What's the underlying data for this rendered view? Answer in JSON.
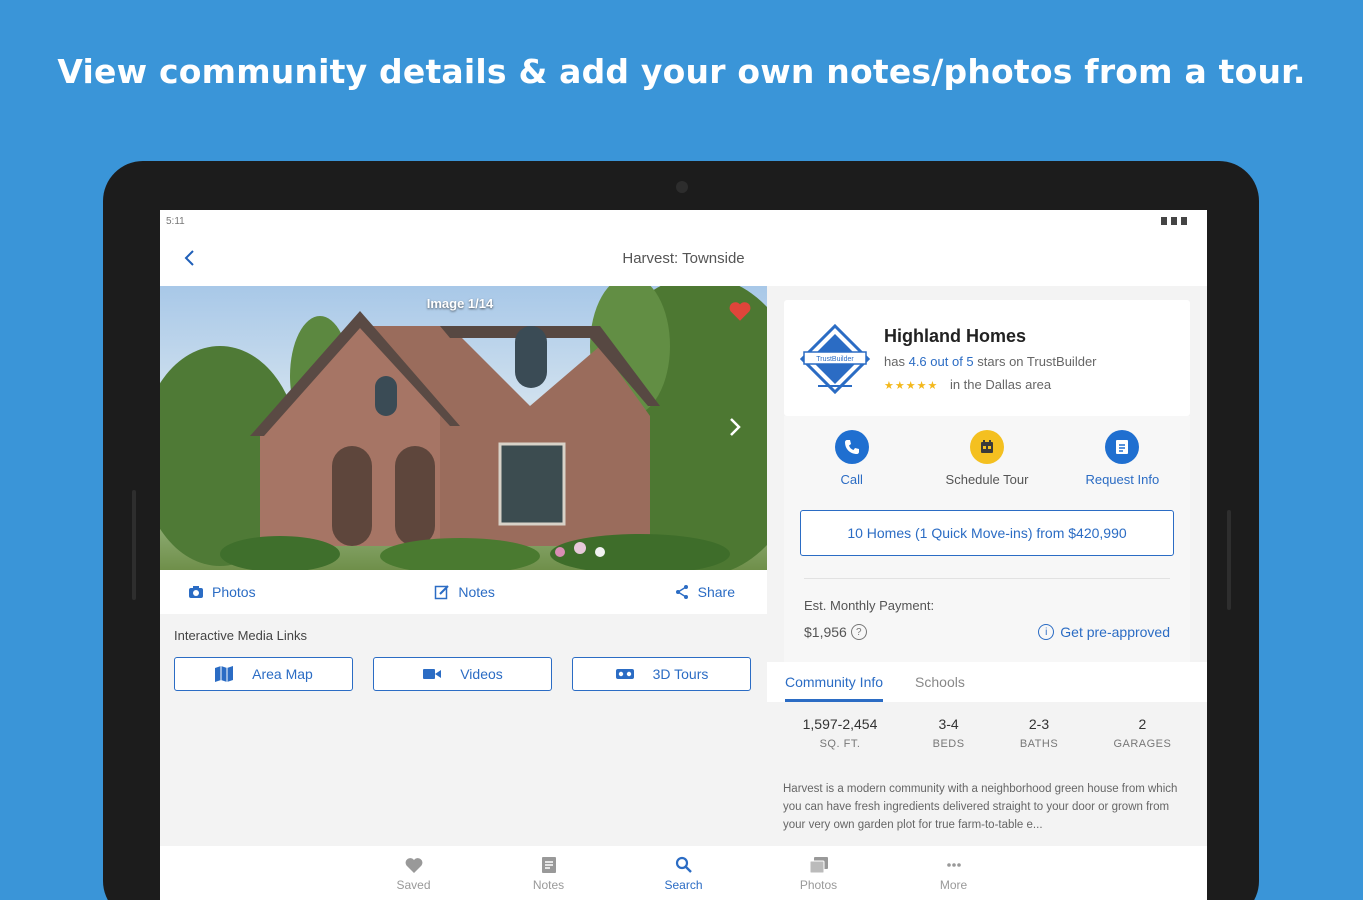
{
  "headline": "View community details & add your own notes/photos from a tour.",
  "status_bar": {
    "time": "5:11"
  },
  "app_bar": {
    "title": "Harvest: Townside"
  },
  "gallery": {
    "image_counter": "Image 1/14"
  },
  "photo_actions": {
    "photos": "Photos",
    "notes": "Notes",
    "share": "Share"
  },
  "media_links": {
    "title": "Interactive Media Links",
    "area_map": "Area Map",
    "videos": "Videos",
    "tours_3d": "3D Tours"
  },
  "builder": {
    "name": "Highland Homes",
    "rating_prefix": "has",
    "rating": "4.6 out of 5",
    "rating_suffix": "stars on TrustBuilder",
    "stars": "★★★★★",
    "area": "in the Dallas area",
    "logo_text": "TrustBuilder"
  },
  "contact": {
    "call": "Call",
    "schedule_tour": "Schedule Tour",
    "request_info": "Request Info",
    "call_color": "#1f6fd0",
    "schedule_color": "#f4c020",
    "request_color": "#1f6fd0"
  },
  "homes_button": "10 Homes (1 Quick Move-ins) from $420,990",
  "payment": {
    "label": "Est. Monthly Payment:",
    "value": "$1,956",
    "preapproved": "Get pre-approved"
  },
  "tabs": [
    {
      "label": "Community Info"
    },
    {
      "label": "Schools"
    }
  ],
  "stats": [
    {
      "value": "1,597-2,454",
      "label": "SQ. FT."
    },
    {
      "value": "3-4",
      "label": "BEDS"
    },
    {
      "value": "2-3",
      "label": "BATHS"
    },
    {
      "value": "2",
      "label": "GARAGES"
    }
  ],
  "description": "Harvest is a modern community with a neighborhood green house from which you can have fresh ingredients delivered straight to your door or grown from your very own garden plot for true farm-to-table e...",
  "bottom_nav": [
    {
      "label": "Saved"
    },
    {
      "label": "Notes"
    },
    {
      "label": "Search"
    },
    {
      "label": "Photos"
    },
    {
      "label": "More"
    }
  ],
  "colors": {
    "background": "#3a95d8",
    "accent": "#2b6cc4",
    "heart": "#e0453a"
  }
}
